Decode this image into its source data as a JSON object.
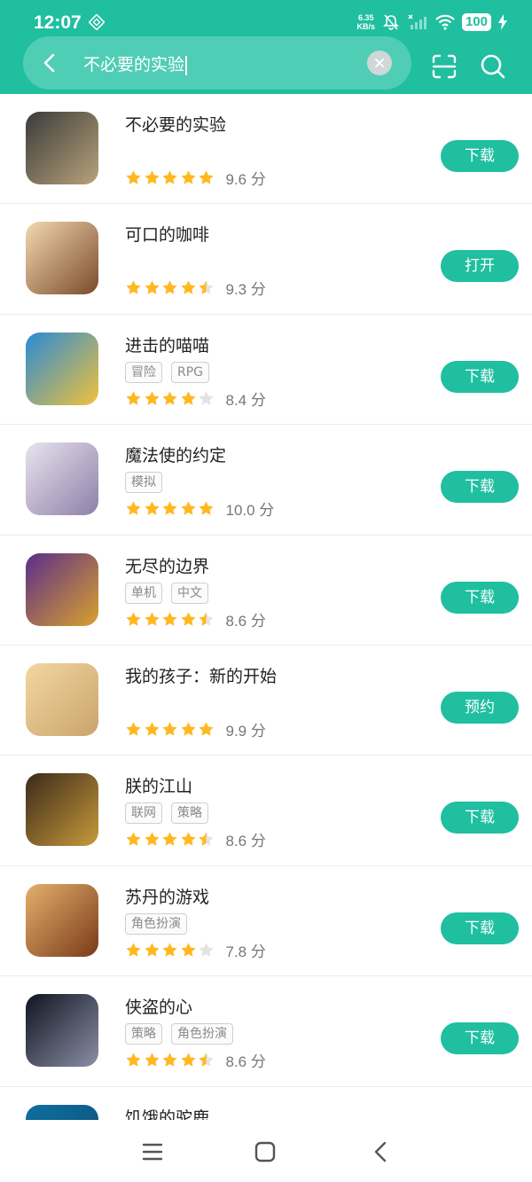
{
  "status": {
    "time": "12:07",
    "netspeed_value": "6.35",
    "netspeed_unit": "KB/s",
    "battery": "100"
  },
  "search": {
    "query": "不必要的实验"
  },
  "colors": {
    "accent": "#1fbfa0",
    "star": "#ffb81f",
    "star_empty": "#e3e3e3"
  },
  "apps": [
    {
      "name": "不必要的实验",
      "tags": [],
      "rating": 5,
      "score": "9.6 分",
      "action": "下载"
    },
    {
      "name": "可口的咖啡",
      "tags": [],
      "rating": 4.5,
      "score": "9.3 分",
      "action": "打开"
    },
    {
      "name": "进击的喵喵",
      "tags": [
        "冒险",
        "RPG"
      ],
      "rating": 4,
      "score": "8.4 分",
      "action": "下载"
    },
    {
      "name": "魔法使的约定",
      "tags": [
        "模拟"
      ],
      "rating": 5,
      "score": "10.0 分",
      "action": "下载"
    },
    {
      "name": "无尽的边界",
      "tags": [
        "单机",
        "中文"
      ],
      "rating": 4.5,
      "score": "8.6 分",
      "action": "下载"
    },
    {
      "name": "我的孩子：新的开始",
      "tags": [],
      "rating": 5,
      "score": "9.9 分",
      "action": "预约"
    },
    {
      "name": "朕的江山",
      "tags": [
        "联网",
        "策略"
      ],
      "rating": 4.5,
      "score": "8.6 分",
      "action": "下载"
    },
    {
      "name": "苏丹的游戏",
      "tags": [
        "角色扮演"
      ],
      "rating": 4,
      "score": "7.8 分",
      "action": "下载"
    },
    {
      "name": "侠盗的心",
      "tags": [
        "策略",
        "角色扮演"
      ],
      "rating": 4.5,
      "score": "8.6 分",
      "action": "下载"
    },
    {
      "name": "饥饿的驼鹿",
      "tags": [],
      "rating": 0,
      "score": "",
      "action": ""
    }
  ]
}
